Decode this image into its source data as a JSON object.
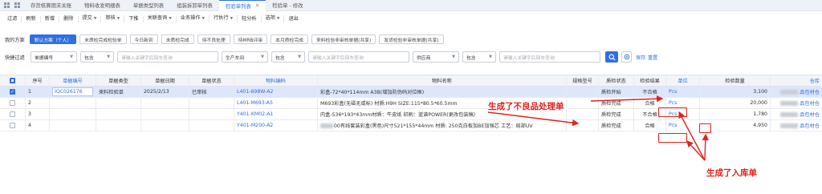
{
  "tabs": [
    {
      "label": "存货核算期末关账",
      "active": false,
      "closable": false
    },
    {
      "label": "物料收发明细表",
      "active": false,
      "closable": false
    },
    {
      "label": "单据类型列表",
      "active": false,
      "closable": false
    },
    {
      "label": "组装拆卸单列表",
      "active": false,
      "closable": false
    },
    {
      "label": "检验单列表",
      "active": true,
      "closable": true
    },
    {
      "label": "检验单 - 修改",
      "active": false,
      "closable": false
    }
  ],
  "toolbar": [
    {
      "label": "过滤",
      "dropdown": false
    },
    {
      "label": "刷新",
      "dropdown": false
    },
    {
      "label": "新增",
      "dropdown": false
    },
    {
      "label": "删除",
      "dropdown": false
    },
    {
      "label": "提交",
      "dropdown": true
    },
    {
      "label": "审核",
      "dropdown": true
    },
    {
      "label": "下推",
      "dropdown": false
    },
    {
      "label": "关联查询",
      "dropdown": true
    },
    {
      "label": "业务操作",
      "dropdown": true
    },
    {
      "label": "行执行",
      "dropdown": true
    },
    {
      "label": "轻分析",
      "dropdown": false
    },
    {
      "label": "选项",
      "dropdown": true
    },
    {
      "label": "退出",
      "dropdown": false
    }
  ],
  "plans": {
    "label": "我的方案",
    "items": [
      {
        "label": "默认方案（个人）",
        "primary": true
      },
      {
        "label": "未质检完成检验单",
        "primary": false
      },
      {
        "label": "今日新到",
        "primary": false
      },
      {
        "label": "未质检完成",
        "primary": false
      },
      {
        "label": "待不良处理",
        "primary": false
      },
      {
        "label": "待MRB评审",
        "primary": false
      },
      {
        "label": "本月质检完成",
        "primary": false
      },
      {
        "label": "来料检验非审核单据(共享)",
        "primary": false
      },
      {
        "label": "发货检验非审核单据(共享)",
        "primary": false
      }
    ]
  },
  "filter": {
    "label": "快捷过滤",
    "f1_field": "单据编号",
    "f1_op": "包含",
    "f1_placeholder": "请输入关键字后回车查询",
    "f2_field": "生产车间",
    "f2_op": "包含",
    "f2_placeholder": "请输入关键字后回车查询",
    "f3_field": "供应商",
    "f3_op": "包含",
    "f3_placeholder": "请输入关键字后回车查询",
    "save_label": "保存",
    "reset_label": "重置"
  },
  "table": {
    "headers": {
      "seq": "序号",
      "bill_no": "单据编号",
      "bill_type": "单据类型",
      "date": "单据日期",
      "status": "单据状态",
      "material_code": "物料编码",
      "material_name": "物料名称",
      "spec": "规格型号",
      "qc_status": "质检状态",
      "result": "检验结果",
      "unit": "单位",
      "qty": "检验数量",
      "warehouse": "仓库"
    },
    "rows": [
      {
        "seq": "1",
        "bill_no": "IQC026176",
        "bill_type": "来料检验单",
        "date": "2025/2/13",
        "status": "已审核",
        "material_code": "L401-698W-A2",
        "material_name": "彩盒-72*40*114mm A3B(增加防伪码对位框)",
        "qc_status": "质检开始",
        "result": "不合格",
        "unit": "Pcs",
        "qty": "3,100",
        "warehouse": "品包材仓",
        "selected": true
      },
      {
        "seq": "2",
        "bill_no": "",
        "bill_type": "",
        "date": "",
        "status": "",
        "material_code": "L401-M693-A5",
        "material_name": "M693彩盒(无磁无咸标) 材质:H9H SIZE:115*80.5*60.5mm",
        "qc_status": "质检完成",
        "result": "合格",
        "unit": "Pcs",
        "qty": "20,000",
        "warehouse": "品包材仓",
        "selected": false
      },
      {
        "seq": "3",
        "bill_no": "",
        "bill_type": "",
        "date": "",
        "status": "",
        "material_code": "Y401-KM02-A1",
        "material_name": "内盒-536*193*43mm材质：牛皮纸  印刷：蓝谱POWER(更改包装稿)",
        "qc_status": "质检完成",
        "result": "不合格",
        "unit": "Pcs",
        "qty": "1,780",
        "warehouse": "品包材仓",
        "selected": false
      },
      {
        "seq": "4",
        "bill_no": "",
        "bill_type": "",
        "date": "",
        "status": "",
        "material_code": "Y401-M200-A2",
        "material_name": "00有线套装彩盒(黑色)尺寸521*155*44mm 材质:  250克白板加BE加强芯 工艺：局部UV",
        "qc_status": "质检完成",
        "result": "合格",
        "unit": "Pcs",
        "qty": "4,950",
        "warehouse": "品包材仓",
        "selected": false
      }
    ]
  },
  "annotations": {
    "defect_note": "生成了不良品处理单",
    "receipt_note": "生成了入库单",
    "color": "#e0231b"
  },
  "colors": {
    "accent": "#2f6fe6",
    "selected_row": "#dde6fb",
    "annotation": "#e0231b"
  }
}
